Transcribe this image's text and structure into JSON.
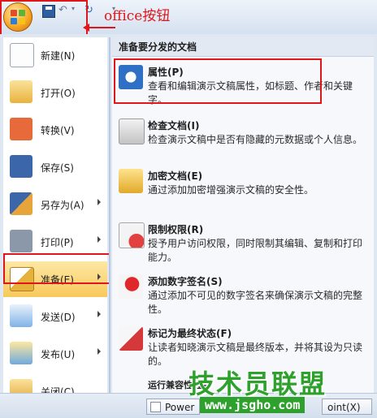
{
  "annotation": {
    "office_label": "office按钮"
  },
  "menu": {
    "left_items": [
      {
        "label": "新建(N)",
        "icon": "new-document-icon"
      },
      {
        "label": "打开(O)",
        "icon": "open-folder-icon"
      },
      {
        "label": "转换(V)",
        "icon": "convert-icon"
      },
      {
        "label": "保存(S)",
        "icon": "save-disk-icon"
      },
      {
        "label": "另存为(A)",
        "icon": "save-as-icon",
        "has_submenu": true
      },
      {
        "label": "打印(P)",
        "icon": "printer-icon",
        "has_submenu": true
      },
      {
        "label": "准备(E)",
        "icon": "prepare-icon",
        "has_submenu": true,
        "active": true
      },
      {
        "label": "发送(D)",
        "icon": "send-icon",
        "has_submenu": true
      },
      {
        "label": "发布(U)",
        "icon": "publish-icon",
        "has_submenu": true
      },
      {
        "label": "关闭(C)",
        "icon": "close-folder-icon"
      }
    ],
    "right_header": "准备要分发的文档",
    "right_items": [
      {
        "title": "属性(P)",
        "desc": "查看和编辑演示文稿属性，如标题、作者和关键字。",
        "icon": "properties-icon"
      },
      {
        "title": "检查文档(I)",
        "desc": "检查演示文稿中是否有隐藏的元数据或个人信息。",
        "icon": "inspect-document-icon"
      },
      {
        "title": "加密文档(E)",
        "desc": "通过添加加密增强演示文稿的安全性。",
        "icon": "encrypt-lock-icon"
      },
      {
        "title": "限制权限(R)",
        "desc": "授予用户访问权限，同时限制其编辑、复制和打印能力。",
        "icon": "restrict-permission-icon"
      },
      {
        "title": "添加数字签名(S)",
        "desc": "通过添加不可见的数字签名来确保演示文稿的完整性。",
        "icon": "digital-signature-icon"
      },
      {
        "title": "标记为最终状态(F)",
        "desc": "让读者知晓演示文稿是最终版本，并将其设为只读的。",
        "icon": "mark-final-icon"
      }
    ],
    "cut_row": "运行兼容性检查"
  },
  "bottom_bar": {
    "options_label": "Power",
    "exit_label": "oint(X)"
  },
  "watermark": {
    "main": "技术员联盟",
    "url": "www.jsgho.com"
  },
  "colors": {
    "annotation_red": "#e0171a",
    "active_highlight": "#f8c95b",
    "watermark_green": "#2ea12d"
  }
}
